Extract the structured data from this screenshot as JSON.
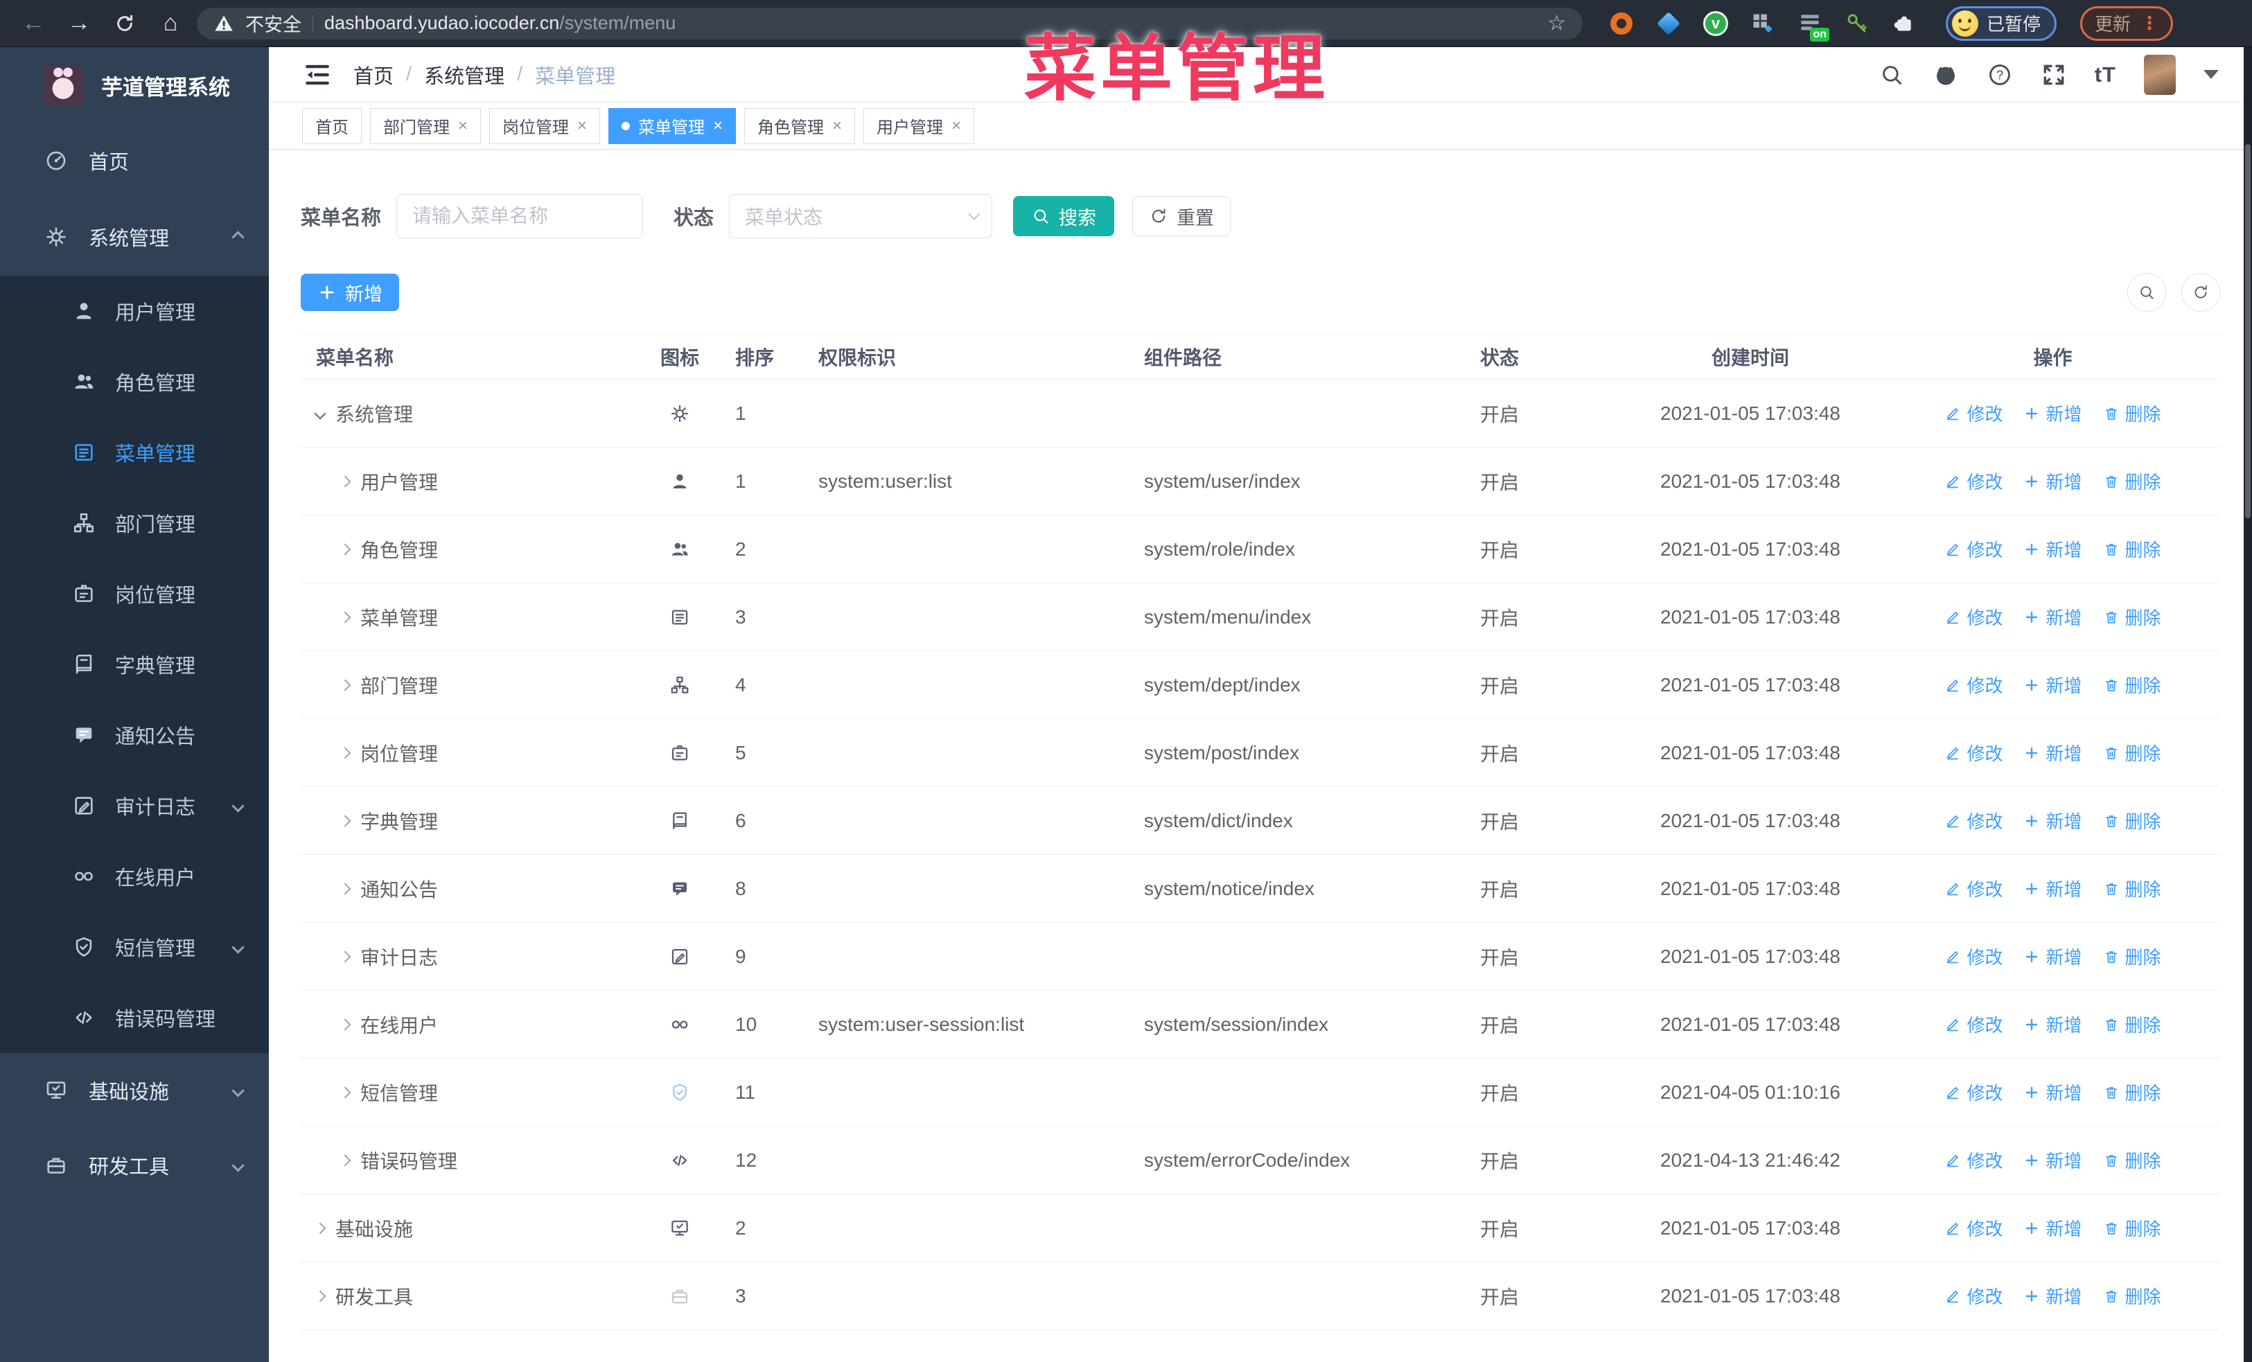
{
  "browser": {
    "security_label": "不安全",
    "url_host": "dashboard.yudao.iocoder.cn",
    "url_path": "/system/menu",
    "extension_badge": "on",
    "profile_label": "已暂停",
    "update_label": "更新",
    "extension_icons": [
      "orange-ring-icon",
      "blue-gem-icon",
      "green-check-circle-icon",
      "grid-diamond-icon",
      "stack-on-icon",
      "green-key-icon",
      "puzzle-icon"
    ]
  },
  "overlay_title": "菜单管理",
  "sidebar": {
    "app_title": "芋道管理系统",
    "items": [
      {
        "group": "main",
        "label": "首页",
        "icon": "home"
      },
      {
        "group": "main",
        "label": "系统管理",
        "icon": "gear",
        "chevron": "up",
        "open": true
      },
      {
        "group": "sub",
        "label": "用户管理",
        "icon": "user"
      },
      {
        "group": "sub",
        "label": "角色管理",
        "icon": "users"
      },
      {
        "group": "sub",
        "label": "菜单管理",
        "icon": "menu",
        "active": true
      },
      {
        "group": "sub",
        "label": "部门管理",
        "icon": "tree"
      },
      {
        "group": "sub",
        "label": "岗位管理",
        "icon": "badge"
      },
      {
        "group": "sub",
        "label": "字典管理",
        "icon": "book"
      },
      {
        "group": "sub",
        "label": "通知公告",
        "icon": "notice"
      },
      {
        "group": "sub",
        "label": "审计日志",
        "icon": "log",
        "chevron": "down"
      },
      {
        "group": "sub",
        "label": "在线用户",
        "icon": "online"
      },
      {
        "group": "sub",
        "label": "短信管理",
        "icon": "sms",
        "chevron": "down",
        "icon_class": "light-blue"
      },
      {
        "group": "sub",
        "label": "错误码管理",
        "icon": "code"
      },
      {
        "group": "tail",
        "label": "基础设施",
        "icon": "infra",
        "chevron": "down"
      },
      {
        "group": "tail",
        "label": "研发工具",
        "icon": "tool",
        "chevron": "down"
      }
    ]
  },
  "navbar": {
    "breadcrumb": [
      "首页",
      "系统管理",
      "菜单管理"
    ],
    "right_icons": [
      "search-icon",
      "github-icon",
      "help-icon",
      "fullscreen-icon",
      "font-size-icon"
    ],
    "font_size_text": "tT"
  },
  "tabs": [
    {
      "label": "首页",
      "closable": false
    },
    {
      "label": "部门管理",
      "closable": true
    },
    {
      "label": "岗位管理",
      "closable": true
    },
    {
      "label": "菜单管理",
      "closable": true,
      "active": true
    },
    {
      "label": "角色管理",
      "closable": true
    },
    {
      "label": "用户管理",
      "closable": true
    }
  ],
  "filters": {
    "name_label": "菜单名称",
    "name_placeholder": "请输入菜单名称",
    "status_label": "状态",
    "status_placeholder": "菜单状态",
    "search_label": "搜索",
    "reset_label": "重置"
  },
  "toolbar": {
    "add_label": "新增"
  },
  "table": {
    "columns": [
      {
        "key": "name",
        "label": "菜单名称"
      },
      {
        "key": "icon",
        "label": "图标"
      },
      {
        "key": "sort",
        "label": "排序"
      },
      {
        "key": "perm",
        "label": "权限标识"
      },
      {
        "key": "path",
        "label": "组件路径"
      },
      {
        "key": "status",
        "label": "状态"
      },
      {
        "key": "time",
        "label": "创建时间"
      },
      {
        "key": "actions",
        "label": "操作"
      }
    ],
    "actions": [
      {
        "label": "修改",
        "icon": "pen"
      },
      {
        "label": "新增",
        "icon": "plus"
      },
      {
        "label": "删除",
        "icon": "trash"
      }
    ],
    "rows": [
      {
        "level": 0,
        "expanded": true,
        "name": "系统管理",
        "icon": "gear",
        "sort": "1",
        "perm": "",
        "path": "",
        "status": "开启",
        "time": "2021-01-05 17:03:48"
      },
      {
        "level": 1,
        "name": "用户管理",
        "icon": "user",
        "sort": "1",
        "perm": "system:user:list",
        "path": "system/user/index",
        "status": "开启",
        "time": "2021-01-05 17:03:48"
      },
      {
        "level": 1,
        "name": "角色管理",
        "icon": "users",
        "sort": "2",
        "perm": "",
        "path": "system/role/index",
        "status": "开启",
        "time": "2021-01-05 17:03:48"
      },
      {
        "level": 1,
        "name": "菜单管理",
        "icon": "menu",
        "sort": "3",
        "perm": "",
        "path": "system/menu/index",
        "status": "开启",
        "time": "2021-01-05 17:03:48"
      },
      {
        "level": 1,
        "name": "部门管理",
        "icon": "tree",
        "sort": "4",
        "perm": "",
        "path": "system/dept/index",
        "status": "开启",
        "time": "2021-01-05 17:03:48"
      },
      {
        "level": 1,
        "name": "岗位管理",
        "icon": "badge",
        "sort": "5",
        "perm": "",
        "path": "system/post/index",
        "status": "开启",
        "time": "2021-01-05 17:03:48"
      },
      {
        "level": 1,
        "name": "字典管理",
        "icon": "book",
        "sort": "6",
        "perm": "",
        "path": "system/dict/index",
        "status": "开启",
        "time": "2021-01-05 17:03:48"
      },
      {
        "level": 1,
        "name": "通知公告",
        "icon": "notice",
        "sort": "8",
        "perm": "",
        "path": "system/notice/index",
        "status": "开启",
        "time": "2021-01-05 17:03:48"
      },
      {
        "level": 1,
        "name": "审计日志",
        "icon": "log",
        "sort": "9",
        "perm": "",
        "path": "",
        "status": "开启",
        "time": "2021-01-05 17:03:48"
      },
      {
        "level": 1,
        "name": "在线用户",
        "icon": "online",
        "sort": "10",
        "perm": "system:user-session:list",
        "path": "system/session/index",
        "status": "开启",
        "time": "2021-01-05 17:03:48"
      },
      {
        "level": 1,
        "name": "短信管理",
        "icon": "sms",
        "icon_class": "light-blue",
        "sort": "11",
        "perm": "",
        "path": "",
        "status": "开启",
        "time": "2021-04-05 01:10:16"
      },
      {
        "level": 1,
        "name": "错误码管理",
        "icon": "code",
        "sort": "12",
        "perm": "",
        "path": "system/errorCode/index",
        "status": "开启",
        "time": "2021-04-13 21:46:42"
      },
      {
        "level": 0,
        "name": "基础设施",
        "icon": "infra",
        "sort": "2",
        "perm": "",
        "path": "",
        "status": "开启",
        "time": "2021-01-05 17:03:48"
      },
      {
        "level": 0,
        "name": "研发工具",
        "icon": "tool",
        "icon_class": "light-grey",
        "sort": "3",
        "perm": "",
        "path": "",
        "status": "开启",
        "time": "2021-01-05 17:03:48"
      }
    ]
  },
  "colors": {
    "accent_blue": "#409eff",
    "search_teal": "#17b3a6",
    "overlay_red": "#f0395f",
    "sidebar_bg": "#304156",
    "submenu_bg": "#1f2d3d"
  }
}
